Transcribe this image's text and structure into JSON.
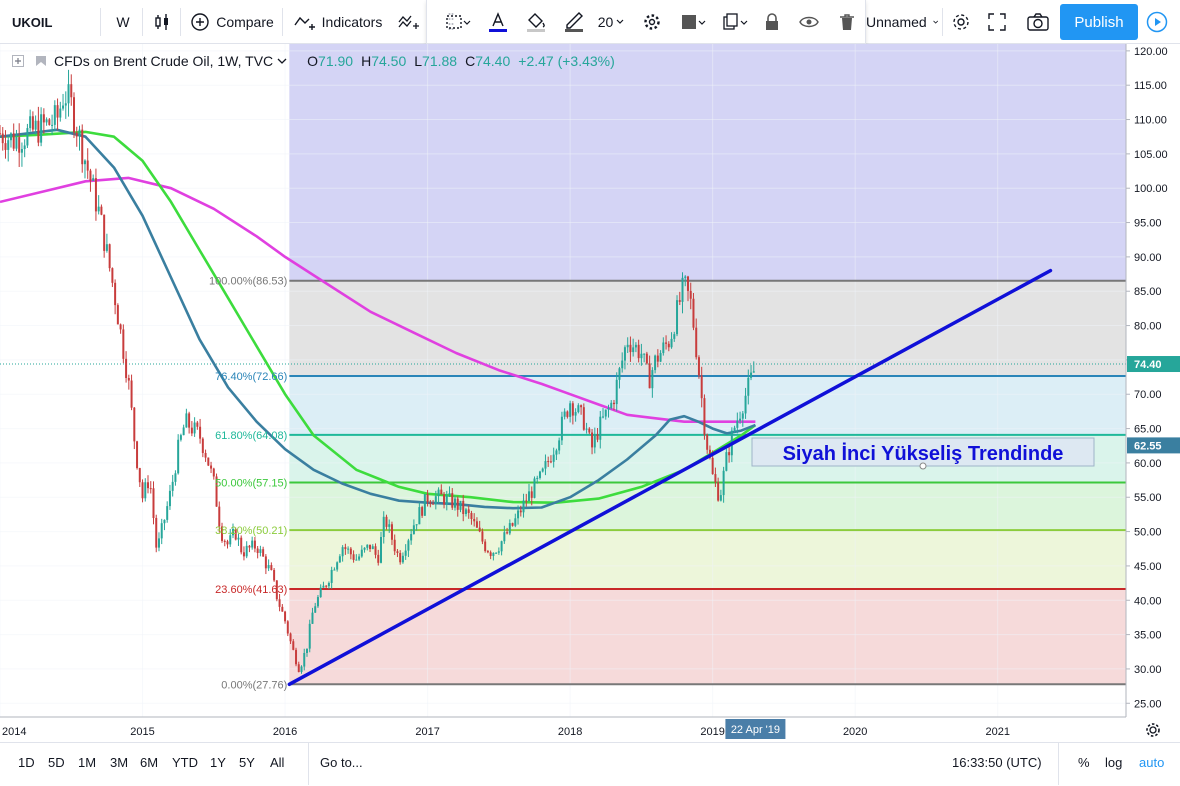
{
  "toolbar": {
    "symbol": "UKOIL",
    "interval": "W",
    "compare_label": "Compare",
    "indicators_label": "Indicators",
    "layout_name": "Unnamed",
    "publish_label": "Publish",
    "font_size": "20"
  },
  "legend": {
    "title": "CFDs on Brent Crude Oil, 1W, TVC",
    "open_label": "O",
    "open": "71.90",
    "high_label": "H",
    "high": "74.50",
    "low_label": "L",
    "low": "71.88",
    "close_label": "C",
    "close": "74.40",
    "change": "+2.47 (+3.43%)"
  },
  "bottombar": {
    "ranges": [
      "1D",
      "5D",
      "1M",
      "3M",
      "6M",
      "YTD",
      "1Y",
      "5Y",
      "All"
    ],
    "goto_label": "Go to...",
    "clock": "16:33:50 (UTC)",
    "percent_label": "%",
    "log_label": "log",
    "auto_label": "auto"
  },
  "colors": {
    "up": "#26a69a",
    "down": "#ef5350",
    "candle": "#c83c3c",
    "trendline": "#1010d8",
    "ma_magenta": "#e040e0",
    "ma_green": "#3ddc3d",
    "ma_teal": "#3a7fa0",
    "annotation_text": "#1010d8"
  },
  "chart_data": {
    "type": "line",
    "title": "CFDs on Brent Crude Oil, 1W, TVC",
    "ylim": [
      23,
      121
    ],
    "yticks": [
      25,
      30,
      35,
      40,
      45,
      50,
      55,
      60,
      65,
      70,
      75,
      80,
      85,
      90,
      95,
      100,
      105,
      110,
      115,
      120
    ],
    "xlim": [
      2014.0,
      2021.9
    ],
    "xticks": [
      {
        "v": 2014.0,
        "label": "2014"
      },
      {
        "v": 2015.0,
        "label": "2015"
      },
      {
        "v": 2016.0,
        "label": "2016"
      },
      {
        "v": 2017.0,
        "label": "2017"
      },
      {
        "v": 2018.0,
        "label": "2018"
      },
      {
        "v": 2019.0,
        "label": "2019"
      },
      {
        "v": 2020.0,
        "label": "2020"
      },
      {
        "v": 2021.0,
        "label": "2021"
      }
    ],
    "current_price": "74.40",
    "ma_price": "62.55",
    "cursor_date": "22 Apr '19",
    "annotation": "Siyah İnci Yükseliş Trendinde",
    "fib_levels": [
      {
        "ratio": 1.0,
        "label": "100.00%(86.53)",
        "price": 86.53,
        "line": "#787878",
        "fill": "#dedede",
        "text": "#787878"
      },
      {
        "ratio": 0.764,
        "label": "76.40%(72.66)",
        "price": 72.66,
        "line": "#2a85b8",
        "fill": "#d6ebf5",
        "text": "#2a85b8"
      },
      {
        "ratio": 0.618,
        "label": "61.80%(64.08)",
        "price": 64.08,
        "line": "#1fb89a",
        "fill": "#d4f2e8",
        "text": "#1fb89a"
      },
      {
        "ratio": 0.5,
        "label": "50.00%(57.15)",
        "price": 57.15,
        "line": "#3cc83c",
        "fill": "#d6f3d6",
        "text": "#3cc83c"
      },
      {
        "ratio": 0.382,
        "label": "38.20%(50.21)",
        "price": 50.21,
        "line": "#8ccc3c",
        "fill": "#eaf5d4",
        "text": "#8ccc3c"
      },
      {
        "ratio": 0.236,
        "label": "23.60%(41.63)",
        "price": 41.63,
        "line": "#c82828",
        "fill": "#f5d4d4",
        "text": "#c82828"
      },
      {
        "ratio": 0.0,
        "label": "0.00%(27.76)",
        "price": 27.76,
        "line": "#787878",
        "fill": "",
        "text": "#787878"
      }
    ],
    "fib_start_x": 2016.03,
    "fib_top_fill": "#d4d4f5",
    "trendline": {
      "x": [
        2016.03,
        2021.37
      ],
      "y": [
        27.76,
        88.0
      ]
    },
    "series": [
      {
        "kind": "price",
        "x": [
          2014.0,
          2014.1,
          2014.2,
          2014.3,
          2014.4,
          2014.45,
          2014.5,
          2014.6,
          2014.7,
          2014.8,
          2014.9,
          2014.95,
          2015.0,
          2015.05,
          2015.1,
          2015.2,
          2015.25,
          2015.3,
          2015.4,
          2015.45,
          2015.5,
          2015.55,
          2015.6,
          2015.65,
          2015.7,
          2015.8,
          2015.9,
          2015.95,
          2016.0,
          2016.05,
          2016.1,
          2016.15,
          2016.2,
          2016.3,
          2016.4,
          2016.5,
          2016.6,
          2016.65,
          2016.7,
          2016.8,
          2016.9,
          2017.0,
          2017.1,
          2017.2,
          2017.3,
          2017.4,
          2017.45,
          2017.5,
          2017.6,
          2017.7,
          2017.8,
          2017.9,
          2018.0,
          2018.1,
          2018.15,
          2018.2,
          2018.3,
          2018.4,
          2018.5,
          2018.55,
          2018.6,
          2018.7,
          2018.75,
          2018.8,
          2018.85,
          2018.9,
          2018.95,
          2019.0,
          2019.05,
          2019.1,
          2019.15,
          2019.2,
          2019.25,
          2019.3
        ],
        "y": [
          108,
          107,
          108,
          109,
          110,
          114,
          112,
          104,
          96,
          85,
          72,
          62,
          55,
          58,
          47,
          56,
          62,
          66,
          64,
          61,
          57,
          50,
          48,
          50,
          47,
          48,
          44,
          40,
          37,
          33,
          30,
          33,
          39,
          43,
          48,
          46,
          48,
          46,
          52,
          46,
          51,
          55,
          55,
          54,
          52,
          48,
          47,
          48,
          51,
          55,
          58,
          63,
          69,
          66,
          62,
          65,
          69,
          78,
          76,
          72,
          75,
          78,
          82,
          86,
          83,
          74,
          64,
          58,
          55,
          61,
          65,
          68,
          71,
          74
        ]
      },
      {
        "kind": "ma",
        "color": "#e040e0",
        "x": [
          2014.0,
          2014.3,
          2014.6,
          2014.9,
          2015.2,
          2015.5,
          2015.8,
          2016.0,
          2016.3,
          2016.6,
          2016.9,
          2017.2,
          2017.5,
          2017.8,
          2018.0,
          2018.2,
          2018.4,
          2018.6,
          2018.8,
          2019.0,
          2019.2,
          2019.3
        ],
        "y": [
          98,
          99.5,
          101,
          101.5,
          100,
          97,
          93,
          90,
          86,
          82,
          79,
          76,
          73.5,
          71.5,
          70,
          68.5,
          67,
          66.5,
          66,
          66,
          66,
          66
        ]
      },
      {
        "kind": "ma",
        "color": "#3ddc3d",
        "x": [
          2014.0,
          2014.3,
          2014.6,
          2014.8,
          2015.0,
          2015.2,
          2015.4,
          2015.6,
          2015.8,
          2016.0,
          2016.2,
          2016.5,
          2016.8,
          2017.0,
          2017.3,
          2017.6,
          2017.9,
          2018.2,
          2018.5,
          2018.8,
          2019.0,
          2019.2,
          2019.3
        ],
        "y": [
          107.5,
          107.8,
          108.2,
          107.5,
          104,
          98,
          91,
          84,
          77,
          70,
          64,
          59,
          56.5,
          55.5,
          55,
          54.3,
          54.2,
          54.8,
          56.5,
          59,
          61.5,
          64,
          65.5
        ]
      },
      {
        "kind": "ma",
        "color": "#3a7fa0",
        "x": [
          2014.0,
          2014.2,
          2014.4,
          2014.6,
          2014.8,
          2015.0,
          2015.2,
          2015.4,
          2015.6,
          2015.8,
          2016.0,
          2016.2,
          2016.4,
          2016.6,
          2016.8,
          2017.0,
          2017.2,
          2017.4,
          2017.6,
          2017.8,
          2018.0,
          2018.2,
          2018.4,
          2018.6,
          2018.7,
          2018.8,
          2018.9,
          2019.0,
          2019.1,
          2019.2,
          2019.3
        ],
        "y": [
          107.5,
          108,
          108.5,
          107.5,
          103,
          96,
          87,
          78,
          71,
          66,
          62,
          59,
          57,
          55.5,
          54.5,
          54.2,
          54,
          53.6,
          53.4,
          53.5,
          55,
          57.5,
          60.5,
          64,
          66.3,
          66.8,
          66,
          65,
          64.3,
          64.7,
          65.5
        ]
      }
    ]
  }
}
